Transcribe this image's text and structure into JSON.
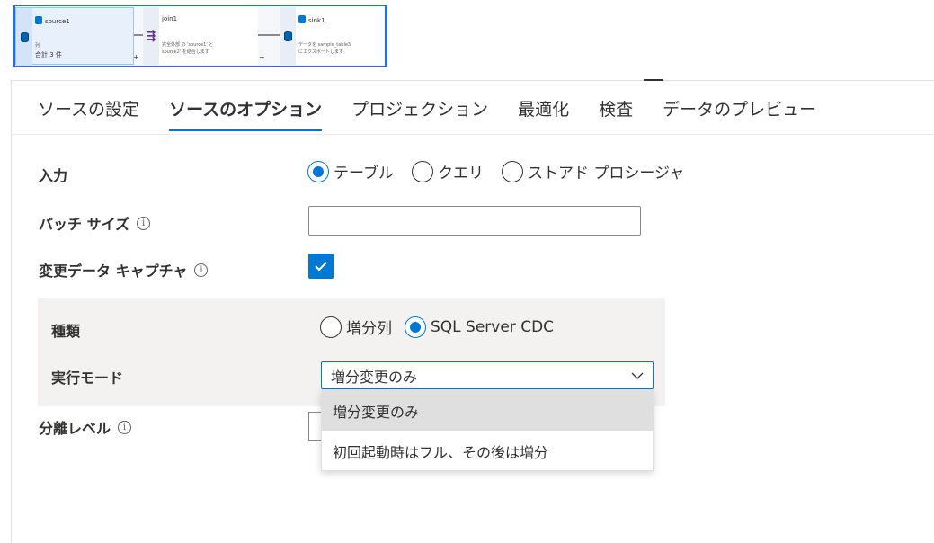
{
  "flow": {
    "source": {
      "title": "source1",
      "desc1": "列:",
      "desc2": "合計 3 件"
    },
    "join": {
      "title": "join1",
      "desc": "完全外部 の 'source1' と\nsource2' を結合します"
    },
    "sink": {
      "title": "sink1",
      "desc": "データを sample_table3\nにエクスポートします"
    },
    "plus": "+"
  },
  "tabs": [
    {
      "label": "ソースの設定",
      "active": false
    },
    {
      "label": "ソースのオプション",
      "active": true
    },
    {
      "label": "プロジェクション",
      "active": false
    },
    {
      "label": "最適化",
      "active": false
    },
    {
      "label": "検査",
      "active": false
    },
    {
      "label": "データのプレビュー",
      "active": false
    }
  ],
  "form": {
    "input": {
      "label": "入力",
      "options": [
        "テーブル",
        "クエリ",
        "ストアド プロシージャ"
      ],
      "selected": "テーブル"
    },
    "batch_size": {
      "label": "バッチ サイズ",
      "value": "",
      "info_icon": "info-icon"
    },
    "cdc": {
      "label": "変更データ キャプチャ",
      "checked": true,
      "info_icon": "info-icon"
    },
    "kind": {
      "label": "種類",
      "options": [
        "増分列",
        "SQL Server CDC"
      ],
      "selected": "SQL Server CDC"
    },
    "run_mode": {
      "label": "実行モード",
      "value": "増分変更のみ",
      "options": [
        "増分変更のみ",
        "初回起動時はフル、その後は増分"
      ]
    },
    "isolation": {
      "label": "分離レベル",
      "info_icon": "info-icon"
    }
  },
  "colors": {
    "accent": "#0078d4",
    "panel": "#f3f2f1",
    "highlight": "#dfdfdf"
  }
}
